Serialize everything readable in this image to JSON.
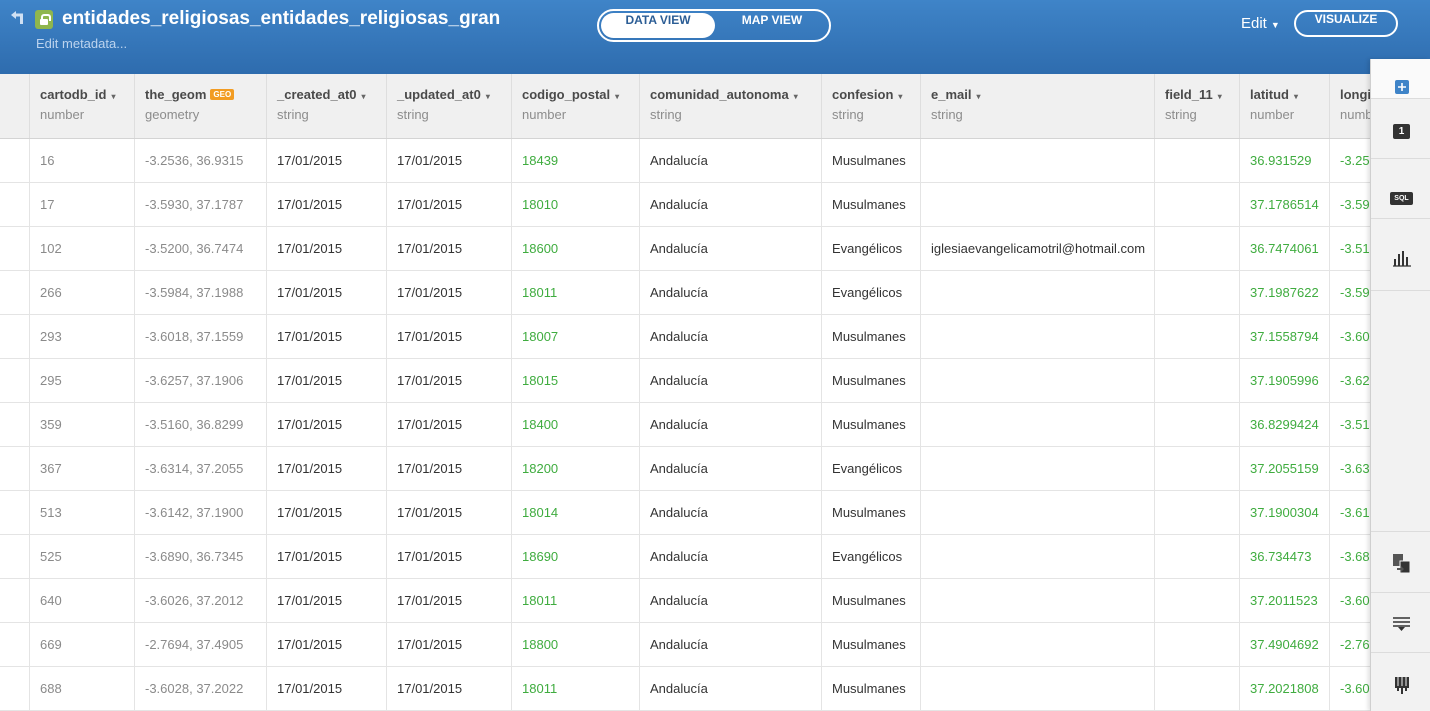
{
  "header": {
    "title": "entidades_religiosas_entidades_religiosas_gran",
    "edit_metadata": "Edit metadata...",
    "data_view": "DATA VIEW",
    "map_view": "MAP VIEW",
    "edit_label": "Edit",
    "visualize": "VISUALIZE",
    "bg_color": "#3a7bc0"
  },
  "columns": [
    {
      "name": "cartodb_id",
      "type": "number",
      "dropdown": "▾"
    },
    {
      "name": "the_geom",
      "type": "geometry",
      "badge": "GEO"
    },
    {
      "name": "_created_at0",
      "type": "string",
      "dropdown": "▾"
    },
    {
      "name": "_updated_at0",
      "type": "string",
      "dropdown": "▾"
    },
    {
      "name": "codigo_postal",
      "type": "number",
      "dropdown": "▾"
    },
    {
      "name": "comunidad_autonoma",
      "type": "string",
      "dropdown": "▾"
    },
    {
      "name": "confesion",
      "type": "string",
      "dropdown": "▾"
    },
    {
      "name": "e_mail",
      "type": "string",
      "dropdown": "▾"
    },
    {
      "name": "field_11",
      "type": "string",
      "dropdown": "▾"
    },
    {
      "name": "latitud",
      "type": "number",
      "dropdown": "▾"
    },
    {
      "name": "longi",
      "type": "numb"
    }
  ],
  "rows": [
    [
      "16",
      "-3.2536, 36.9315",
      "17/01/2015",
      "17/01/2015",
      "18439",
      "Andalucía",
      "Musulmanes",
      "",
      "",
      "36.931529",
      "-3.25"
    ],
    [
      "17",
      "-3.5930, 37.1787",
      "17/01/2015",
      "17/01/2015",
      "18010",
      "Andalucía",
      "Musulmanes",
      "",
      "",
      "37.1786514",
      "-3.59"
    ],
    [
      "102",
      "-3.5200, 36.7474",
      "17/01/2015",
      "17/01/2015",
      "18600",
      "Andalucía",
      "Evangélicos",
      "iglesiaevangelicamotril@hotmail.com",
      "",
      "36.7474061",
      "-3.51"
    ],
    [
      "266",
      "-3.5984, 37.1988",
      "17/01/2015",
      "17/01/2015",
      "18011",
      "Andalucía",
      "Evangélicos",
      "",
      "",
      "37.1987622",
      "-3.59"
    ],
    [
      "293",
      "-3.6018, 37.1559",
      "17/01/2015",
      "17/01/2015",
      "18007",
      "Andalucía",
      "Musulmanes",
      "",
      "",
      "37.1558794",
      "-3.60"
    ],
    [
      "295",
      "-3.6257, 37.1906",
      "17/01/2015",
      "17/01/2015",
      "18015",
      "Andalucía",
      "Musulmanes",
      "",
      "",
      "37.1905996",
      "-3.62"
    ],
    [
      "359",
      "-3.5160, 36.8299",
      "17/01/2015",
      "17/01/2015",
      "18400",
      "Andalucía",
      "Musulmanes",
      "",
      "",
      "36.8299424",
      "-3.51"
    ],
    [
      "367",
      "-3.6314, 37.2055",
      "17/01/2015",
      "17/01/2015",
      "18200",
      "Andalucía",
      "Evangélicos",
      "",
      "",
      "37.2055159",
      "-3.63"
    ],
    [
      "513",
      "-3.6142, 37.1900",
      "17/01/2015",
      "17/01/2015",
      "18014",
      "Andalucía",
      "Musulmanes",
      "",
      "",
      "37.1900304",
      "-3.61"
    ],
    [
      "525",
      "-3.6890, 36.7345",
      "17/01/2015",
      "17/01/2015",
      "18690",
      "Andalucía",
      "Evangélicos",
      "",
      "",
      "36.734473",
      "-3.68"
    ],
    [
      "640",
      "-3.6026, 37.2012",
      "17/01/2015",
      "17/01/2015",
      "18011",
      "Andalucía",
      "Musulmanes",
      "",
      "",
      "37.2011523",
      "-3.60"
    ],
    [
      "669",
      "-2.7694, 37.4905",
      "17/01/2015",
      "17/01/2015",
      "18800",
      "Andalucía",
      "Musulmanes",
      "",
      "",
      "37.4904692",
      "-2.76"
    ],
    [
      "688",
      "-3.6028, 37.2022",
      "17/01/2015",
      "17/01/2015",
      "18011",
      "Andalucía",
      "Musulmanes",
      "",
      "",
      "37.2021808",
      "-3.60"
    ]
  ],
  "side_panel": {
    "add_icon": "plus-icon",
    "layer_number": "1",
    "sql_label": "SQL",
    "tools": [
      "add-layer-icon",
      "layer-1-icon",
      "sql-icon",
      "histogram-icon",
      "merge-tables-icon",
      "filter-icon",
      "legend-icon"
    ]
  }
}
